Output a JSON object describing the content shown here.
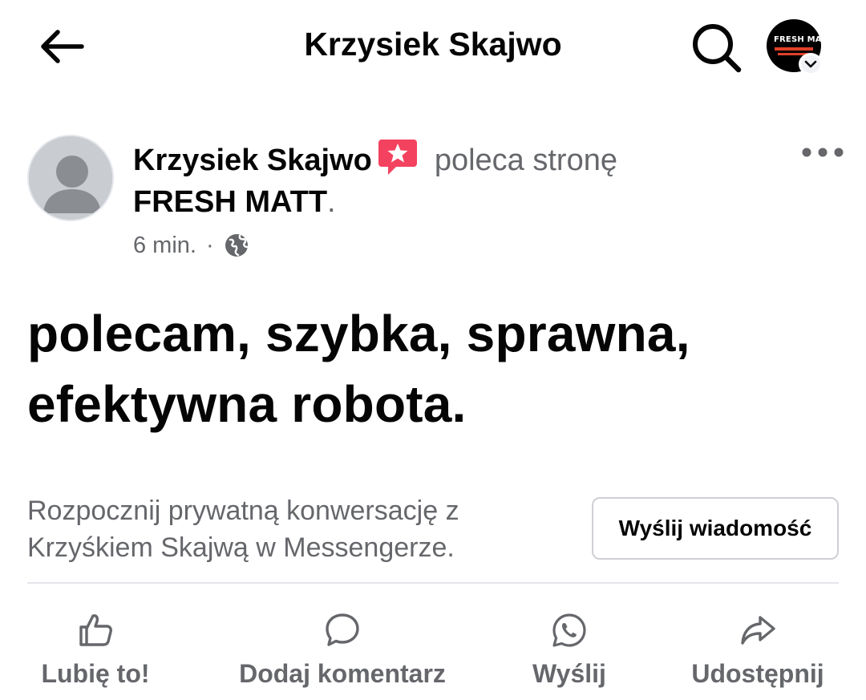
{
  "header": {
    "title": "Krzysiek Skajwo",
    "profile_brand": "FRESH MATT"
  },
  "post": {
    "author": "Krzysiek Skajwo",
    "action_text": "poleca stronę",
    "page_name": "FRESH MATT",
    "time": "6 min.",
    "separator": "·",
    "privacy_icon": "globe-icon",
    "text": "polecam, szybka, sprawna, efektywna robota."
  },
  "messenger": {
    "prompt": "Rozpocznij prywatną konwersację z Krzyśkiem Skajwą w Messengerze.",
    "button_label": "Wyślij wiadomość"
  },
  "actions": {
    "like": "Lubię to!",
    "comment": "Dodaj komentarz",
    "send": "Wyślij",
    "share": "Udostępnij"
  },
  "colors": {
    "text_primary": "#050505",
    "text_secondary": "#65676b",
    "recommend_badge": "#f3425f",
    "brand_accent": "#e0402a",
    "divider": "#e4e6eb"
  }
}
